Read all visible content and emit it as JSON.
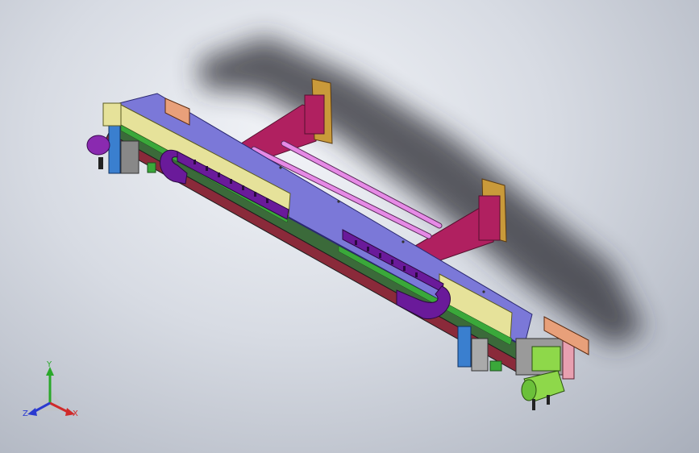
{
  "triad": {
    "x_label": "X",
    "y_label": "Y",
    "z_label": "Z"
  },
  "colors": {
    "background": "#c8ccd4",
    "base_plate": "#7b78d8",
    "frame": "#b02060",
    "rod": "#e68ae6",
    "chain": "#6a1a9a",
    "cover": "#e6e29a",
    "motor": "#8ed84a",
    "bracket": "#c99a3a",
    "support": "#3a7fcf"
  }
}
